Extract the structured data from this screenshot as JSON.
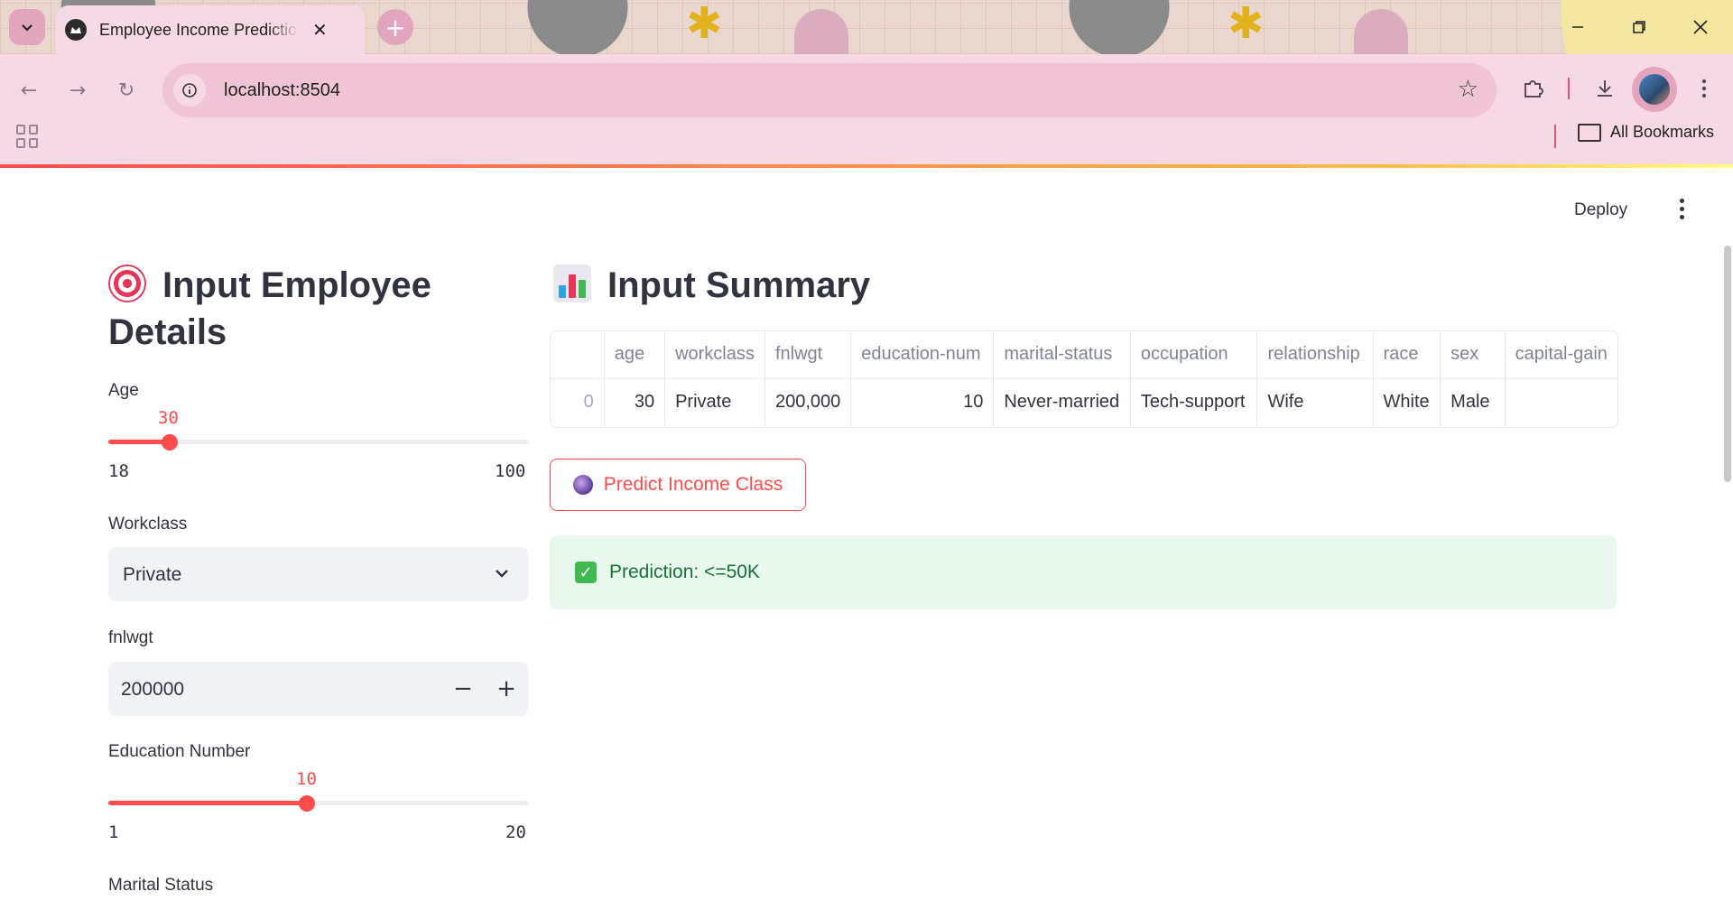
{
  "browser": {
    "tab_title": "Employee Income Prediction App",
    "url": "localhost:8504",
    "bookmarks_label": "All Bookmarks"
  },
  "app_header": {
    "deploy_label": "Deploy"
  },
  "left_panel": {
    "heading": "Input Employee Details",
    "age": {
      "label": "Age",
      "value": "30",
      "min": "18",
      "max": "100",
      "fraction": 0.146
    },
    "workclass": {
      "label": "Workclass",
      "value": "Private"
    },
    "fnlwgt": {
      "label": "fnlwgt",
      "value": "200000",
      "minus": "−",
      "plus": "+"
    },
    "education_number": {
      "label": "Education Number",
      "value": "10",
      "min": "1",
      "max": "20",
      "fraction": 0.474
    },
    "marital_status": {
      "label": "Marital Status"
    }
  },
  "right_panel": {
    "heading": "Input Summary",
    "table": {
      "columns": [
        "",
        "age",
        "workclass",
        "fnlwgt",
        "education-num",
        "marital-status",
        "occupation",
        "relationship",
        "race",
        "sex",
        "capital-gain"
      ],
      "row": [
        "0",
        "30",
        "Private",
        "200,000",
        "10",
        "Never-married",
        "Tech-support",
        "Wife",
        "White",
        "Male",
        ""
      ]
    },
    "predict_button": "Predict Income Class",
    "prediction_text": "Prediction: <=50K"
  },
  "colors": {
    "accent": "#ff4b4b",
    "success_bg": "#e8f8ed",
    "success_text": "#177233",
    "chrome_pink": "#f7d9e5"
  }
}
